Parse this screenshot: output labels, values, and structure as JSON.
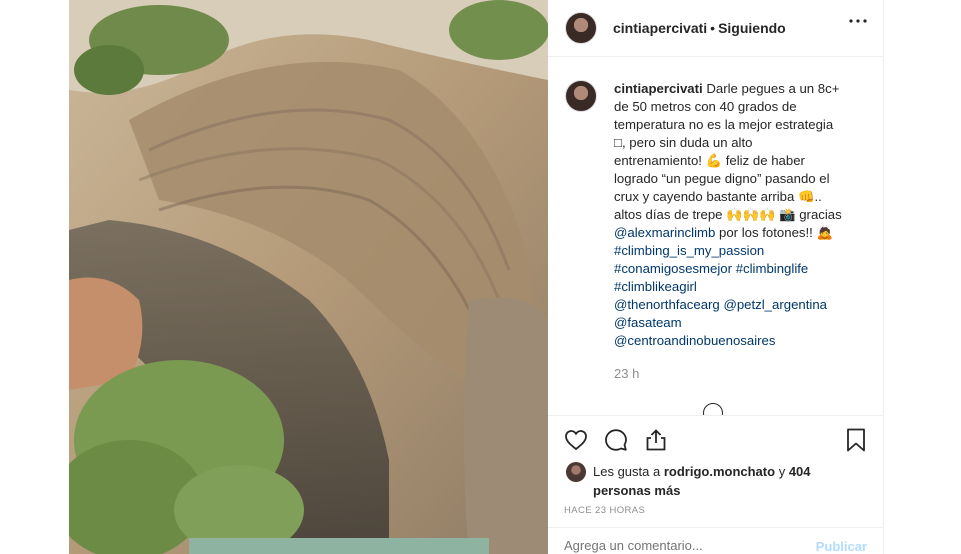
{
  "post": {
    "username": "cintiapercivati",
    "separator": "•",
    "follow_state": "Siguiendo",
    "more_label": "Más opciones"
  },
  "caption": {
    "username": "cintiapercivati",
    "lines": [
      "Darle pegues a un 8c+",
      "de 50 metros con 40 grados de",
      "temperatura no es la mejor estrategia",
      "□, pero sin duda un alto",
      "entrenamiento!",
      "feliz de haber",
      "logrado “un pegue digno” pasando el",
      "crux y cayendo bastante arriba",
      "..",
      "altos días de trepe",
      "gracias",
      "por los fotones!!"
    ],
    "mention_photographer": "@alexmarinclimb",
    "hashtags": [
      "#climbing_is_my_passion",
      "#conamigosesmejor",
      "#climbinglife",
      "#climblikeagirl"
    ],
    "mentions": [
      "@thenorthfacearg",
      "@petzl_argentina",
      "@fasateam",
      "@centroandinobuenosaires"
    ],
    "time_ago": "23 h"
  },
  "actions": {
    "like_icon": "heart-icon",
    "comment_icon": "comment-icon",
    "share_icon": "share-icon",
    "save_icon": "bookmark-icon"
  },
  "likes": {
    "prefix": "Les gusta a",
    "user": "rodrigo.monchato",
    "conjunction": "y",
    "others": "404 personas más"
  },
  "post_date": "HACE 23 HORAS",
  "comment": {
    "placeholder": "Agrega un comentario...",
    "publish_label": "Publicar"
  }
}
